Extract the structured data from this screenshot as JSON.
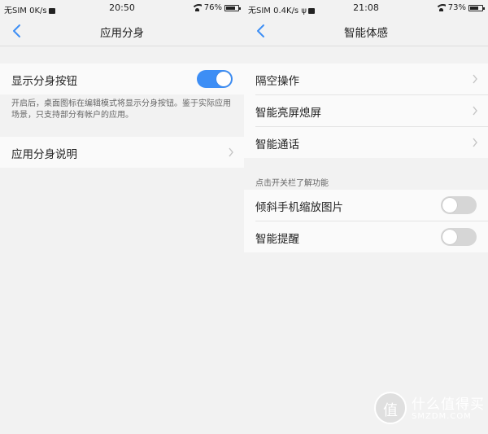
{
  "left_screen": {
    "status": {
      "left_text": "无SIM 0K/s",
      "time": "20:50",
      "battery": "76%",
      "battery_level": 0.76
    },
    "title": "应用分身",
    "toggle_row": {
      "label": "显示分身按钮",
      "enabled": true
    },
    "description": "开启后，桌面图标在编辑模式将显示分身按钮。鉴于实际应用场景，只支持部分有帐户的应用。",
    "info_row": {
      "label": "应用分身说明"
    }
  },
  "right_screen": {
    "status": {
      "left_text": "无SIM 0.4K/s",
      "time": "21:08",
      "battery": "73%",
      "battery_level": 0.73
    },
    "title": "智能体感",
    "nav_items": [
      {
        "label": "隔空操作"
      },
      {
        "label": "智能亮屏熄屏"
      },
      {
        "label": "智能通话"
      }
    ],
    "section_hint": "点击开关栏了解功能",
    "toggle_items": [
      {
        "label": "倾斜手机缩放图片",
        "enabled": false
      },
      {
        "label": "智能提醒",
        "enabled": false
      }
    ]
  },
  "watermark": {
    "glyph": "值",
    "text_cn": "什么值得买",
    "text_en": "SMZDM.COM"
  },
  "colors": {
    "accent": "#3d8ef5",
    "background": "#f2f2f2",
    "card": "#fafafa"
  },
  "icons": [
    "back-arrow-icon",
    "chevron-right-icon",
    "wifi-icon",
    "battery-icon",
    "video-camera-icon",
    "usb-icon"
  ]
}
